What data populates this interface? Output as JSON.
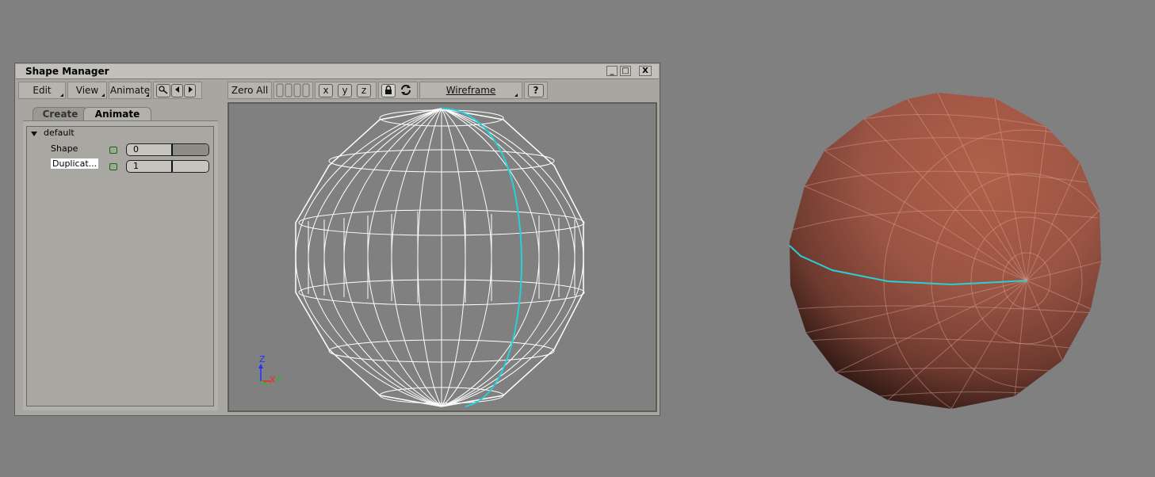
{
  "window": {
    "title": "Shape Manager",
    "controls": {
      "minimize": "_",
      "maximize": "□",
      "close": "X"
    }
  },
  "toolbar": {
    "edit": "Edit",
    "view": "View",
    "animate": "Animate",
    "zero_all": "Zero All",
    "axis_x": "x",
    "axis_y": "y",
    "axis_z": "z",
    "display_mode": "Wireframe",
    "help": "?"
  },
  "tabs": [
    {
      "label": "Create",
      "active": false
    },
    {
      "label": "Animate",
      "active": true
    }
  ],
  "tree": {
    "group": "default",
    "rows": [
      {
        "label": "Shape",
        "value": "0"
      },
      {
        "label": "Duplicat...",
        "value": "1"
      }
    ]
  },
  "axis_gizmo": {
    "z": "Z",
    "x": "X",
    "y": "Y"
  },
  "colors": {
    "highlight_edge": "#27d0d8",
    "sphere_shade": "#a65a46",
    "background": "#808080"
  }
}
